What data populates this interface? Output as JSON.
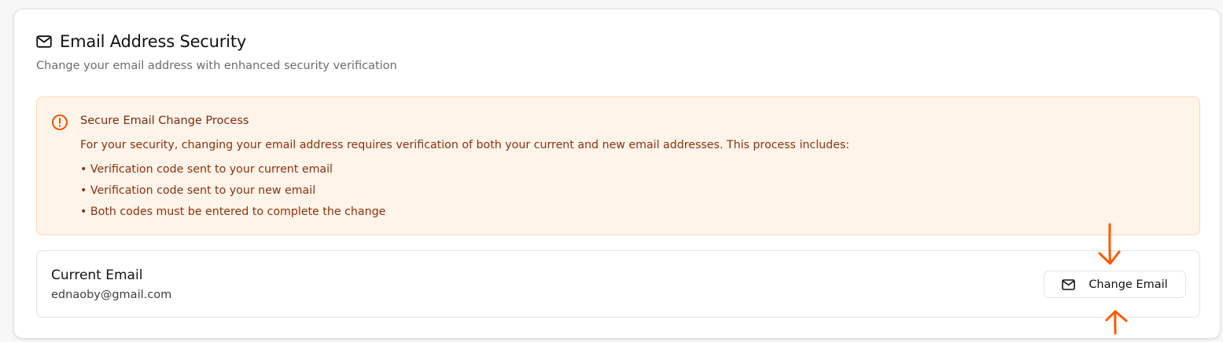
{
  "section": {
    "icon": "mail-icon",
    "title": "Email Address Security",
    "subtitle": "Change your email address with enhanced security verification"
  },
  "alert": {
    "icon": "alert-circle-icon",
    "title": "Secure Email Change Process",
    "text": "For your security, changing your email address requires verification of both your current and new email addresses. This process includes:",
    "items": [
      "• Verification code sent to your current email",
      "• Verification code sent to your new email",
      "• Both codes must be entered to complete the change"
    ],
    "accent_color": "#ea580c",
    "background": "#fff4ea"
  },
  "current_email": {
    "label": "Current Email",
    "value": "ednaoby@gmail.com"
  },
  "change_button": {
    "icon": "mail-icon",
    "label": "Change Email"
  },
  "annotations": {
    "color": "#ff5a00",
    "arrows": [
      "arrow-down-icon",
      "arrow-up-icon"
    ]
  }
}
